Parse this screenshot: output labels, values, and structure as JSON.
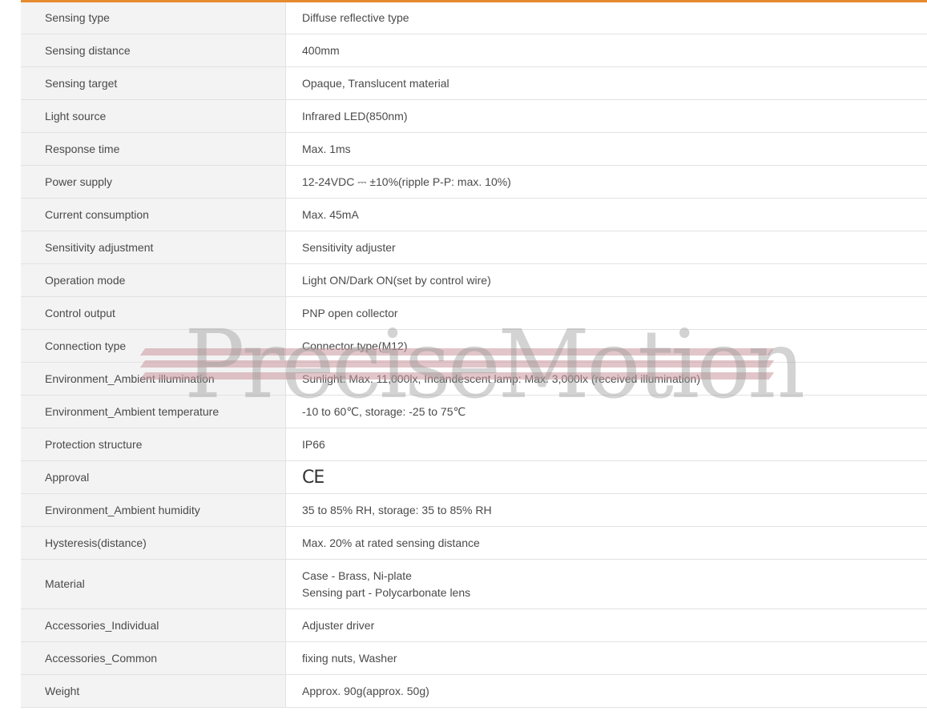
{
  "specs": [
    {
      "label": "Sensing type",
      "value": [
        "Diffuse reflective type"
      ]
    },
    {
      "label": "Sensing distance",
      "value": [
        "400mm"
      ]
    },
    {
      "label": "Sensing target",
      "value": [
        "Opaque, Translucent material"
      ]
    },
    {
      "label": "Light source",
      "value": [
        "Infrared LED(850nm)"
      ]
    },
    {
      "label": "Response time",
      "value": [
        "Max. 1ms"
      ]
    },
    {
      "label": "Power supply",
      "value": [
        "12-24VDC ⎓ ±10%(ripple P-P: max. 10%)"
      ]
    },
    {
      "label": "Current consumption",
      "value": [
        "Max. 45mA"
      ]
    },
    {
      "label": "Sensitivity adjustment",
      "value": [
        "Sensitivity adjuster"
      ]
    },
    {
      "label": "Operation mode",
      "value": [
        "Light ON/Dark ON(set by control wire)"
      ]
    },
    {
      "label": "Control output",
      "value": [
        "PNP open collector"
      ]
    },
    {
      "label": "Connection type",
      "value": [
        "Connector type(M12)"
      ]
    },
    {
      "label": "Environment_Ambient illumination",
      "value": [
        "Sunlight: Max. 11,000lx, Incandescent lamp: Max. 3,000lx (received illumination)"
      ]
    },
    {
      "label": "Environment_Ambient temperature",
      "value": [
        "-10 to 60℃, storage: -25 to 75℃"
      ]
    },
    {
      "label": "Protection structure",
      "value": [
        "IP66"
      ]
    },
    {
      "label": "Approval",
      "value": [
        "CE"
      ]
    },
    {
      "label": "Environment_Ambient humidity",
      "value": [
        "35 to 85% RH, storage: 35 to 85% RH"
      ]
    },
    {
      "label": "Hysteresis(distance)",
      "value": [
        "Max. 20% at rated sensing distance"
      ]
    },
    {
      "label": "Material",
      "value": [
        "Case - Brass, Ni-plate",
        "Sensing part - Polycarbonate lens"
      ]
    },
    {
      "label": "Accessories_Individual",
      "value": [
        "Adjuster driver"
      ]
    },
    {
      "label": "Accessories_Common",
      "value": [
        "fixing nuts, Washer"
      ]
    },
    {
      "label": "Weight",
      "value": [
        "Approx. 90g(approx. 50g)"
      ]
    }
  ],
  "watermark": {
    "text": "PreciseMotion"
  },
  "colors": {
    "accent": "#e68a2e",
    "label_bg": "#f3f3f3",
    "border": "#e2e2e2"
  }
}
